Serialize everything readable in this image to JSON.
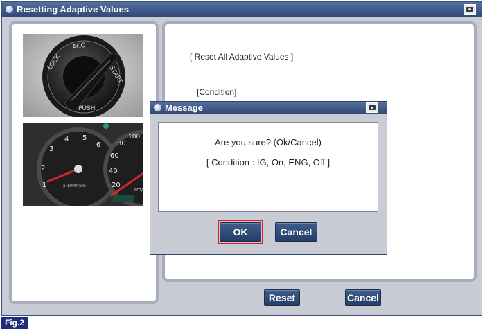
{
  "window": {
    "title": "Resetting Adaptive Values"
  },
  "main": {
    "heading": "[ Reset All Adaptive Values ]",
    "condition_label": "[Condition]"
  },
  "images": {
    "ignition": {
      "labels": [
        "LOCK",
        "ACC",
        "START",
        "PUSH"
      ]
    },
    "cluster": {
      "tacho_ticks": [
        "1",
        "2",
        "3",
        "4",
        "5",
        "6"
      ],
      "tacho_unit": "x 1000rpm",
      "speedo_ticks": [
        "20",
        "40",
        "60",
        "80",
        "100"
      ],
      "speedo_unit": "km/h"
    }
  },
  "buttons": {
    "reset_label": "Reset",
    "cancel_label": "Cancel"
  },
  "dialog": {
    "title": "Message",
    "message": "Are you sure? (Ok/Cancel)",
    "condition": "[ Condition : IG, On, ENG, Off ]",
    "ok_label": "OK",
    "cancel_label": "Cancel"
  },
  "figure_label": "Fig.2",
  "colors": {
    "titlebar": "#2e4673",
    "button": "#2e4a73",
    "window_bg": "#c9ccd5",
    "highlight": "#e8141e",
    "fig_label_bg": "#1d2d7c"
  }
}
